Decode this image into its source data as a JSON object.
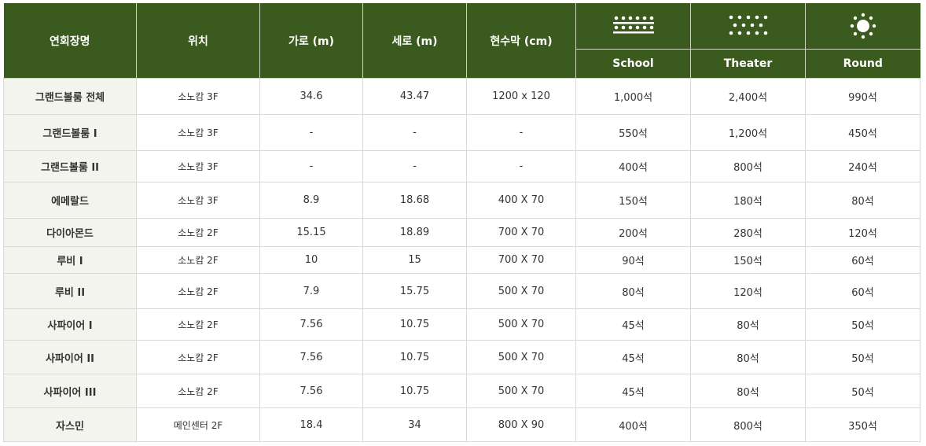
{
  "table": {
    "headers": {
      "name": "연회장명",
      "location": "위치",
      "width": "가로 (m)",
      "length": "세로 (m)",
      "banner": "현수막 (cm)",
      "school": "School",
      "theater": "Theater",
      "round": "Round"
    },
    "icons": {
      "school": "classroom-seating-icon",
      "theater": "theater-seating-icon",
      "round": "round-table-seating-icon"
    },
    "rows": [
      {
        "name": "그랜드볼룸 전체",
        "location": "소노캄 3F",
        "width": "34.6",
        "length": "43.47",
        "banner": "1200 x 120",
        "school": "1,000석",
        "theater": "2,400석",
        "round": "990석"
      },
      {
        "name": "그랜드볼룸 I",
        "location": "소노캄 3F",
        "width": "-",
        "length": "-",
        "banner": "-",
        "school": "550석",
        "theater": "1,200석",
        "round": "450석"
      },
      {
        "name": "그랜드볼룸 II",
        "location": "소노캄 3F",
        "width": "-",
        "length": "-",
        "banner": "-",
        "school": "400석",
        "theater": "800석",
        "round": "240석"
      },
      {
        "name": "에메랄드",
        "location": "소노캄 3F",
        "width": "8.9",
        "length": "18.68",
        "banner": "400 X 70",
        "school": "150석",
        "theater": "180석",
        "round": "80석"
      },
      {
        "name": "다이아몬드",
        "location": "소노캄 2F",
        "width": "15.15",
        "length": "18.89",
        "banner": "700 X 70",
        "school": "200석",
        "theater": "280석",
        "round": "120석"
      },
      {
        "name": "루비 I",
        "location": "소노캄 2F",
        "width": "10",
        "length": "15",
        "banner": "700 X 70",
        "school": "90석",
        "theater": "150석",
        "round": "60석"
      },
      {
        "name": "루비 II",
        "location": "소노캄 2F",
        "width": "7.9",
        "length": "15.75",
        "banner": "500 X 70",
        "school": "80석",
        "theater": "120석",
        "round": "60석"
      },
      {
        "name": "사파이어 I",
        "location": "소노캄 2F",
        "width": "7.56",
        "length": "10.75",
        "banner": "500 X 70",
        "school": "45석",
        "theater": "80석",
        "round": "50석"
      },
      {
        "name": "사파이어 II",
        "location": "소노캄 2F",
        "width": "7.56",
        "length": "10.75",
        "banner": "500 X 70",
        "school": "45석",
        "theater": "80석",
        "round": "50석"
      },
      {
        "name": "사파이어 III",
        "location": "소노캄 2F",
        "width": "7.56",
        "length": "10.75",
        "banner": "500 X 70",
        "school": "45석",
        "theater": "80석",
        "round": "50석"
      },
      {
        "name": "자스민",
        "location": "메인센터 2F",
        "width": "18.4",
        "length": "34",
        "banner": "800 X 90",
        "school": "400석",
        "theater": "800석",
        "round": "350석"
      }
    ]
  }
}
